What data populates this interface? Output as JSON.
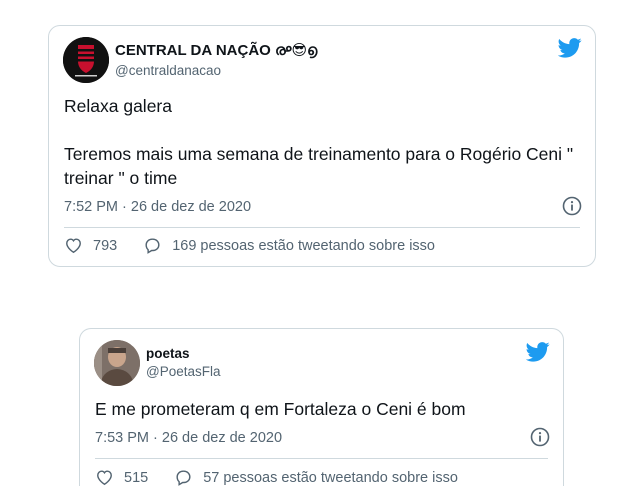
{
  "tweets": [
    {
      "display_name": "CENTRAL DA NAÇÃO ൙😎൭",
      "handle": "@centraldanacao",
      "text": "Relaxa galera\n\nTeremos mais uma semana de treinamento para o Rogério Ceni \" treinar \" o time",
      "timestamp": "7:52 PM · 26 de dez de 2020",
      "likes": "793",
      "conversation": "169 pessoas estão tweetando sobre isso"
    },
    {
      "display_name": "poetas",
      "handle": "@PoetasFla",
      "text": "E me prometeram q em Fortaleza o Ceni é bom",
      "timestamp": "7:53 PM · 26 de dez de 2020",
      "likes": "515",
      "conversation": "57 pessoas estão tweetando sobre isso"
    }
  ],
  "colors": {
    "twitter_blue": "#1d9bf0",
    "secondary_text": "#536471",
    "border": "#cfd9de"
  },
  "icons": [
    "twitter-bird-icon",
    "info-icon",
    "heart-icon",
    "speech-bubble-icon"
  ]
}
